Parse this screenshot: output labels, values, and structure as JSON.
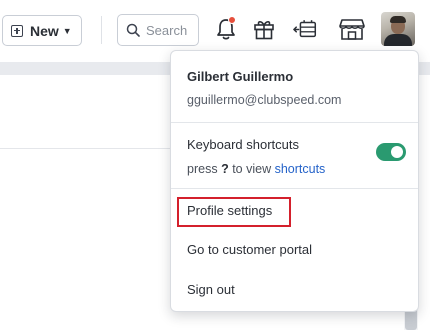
{
  "header": {
    "new_button_label": "New",
    "search_placeholder": "Search",
    "icons": [
      "plus-box-icon",
      "chevron-down-icon",
      "search-icon",
      "bell-icon",
      "gift-icon",
      "queue-icon",
      "store-icon"
    ]
  },
  "user_menu": {
    "name": "Gilbert Guillermo",
    "email": "gguillermo@clubspeed.com",
    "keyboard_shortcuts": {
      "label": "Keyboard shortcuts",
      "hint_prefix": "press",
      "hint_key": "?",
      "hint_middle": "to view",
      "hint_link": "shortcuts",
      "enabled": true
    },
    "items": {
      "profile_settings": "Profile settings",
      "customer_portal": "Go to customer portal",
      "sign_out": "Sign out"
    }
  },
  "colors": {
    "toggle_on": "#2a9a70",
    "highlight": "#d4202c",
    "link": "#2563c9",
    "notification_dot": "#e64f3c"
  }
}
